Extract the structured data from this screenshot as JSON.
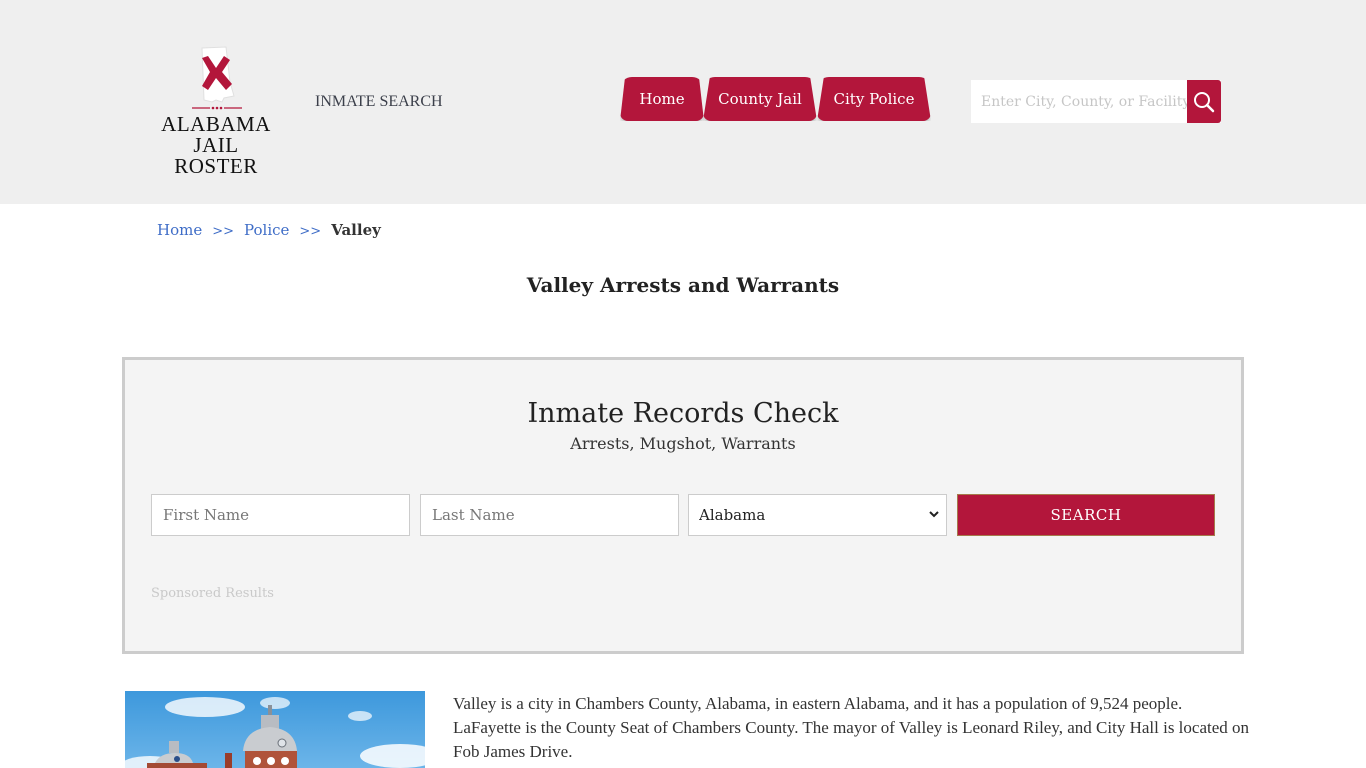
{
  "header": {
    "logo": {
      "line1": "ALABAMA",
      "line2": "JAIL ROSTER",
      "flag_color": "#b3163b"
    },
    "tagline": "INMATE SEARCH",
    "nav": [
      {
        "label": "Home"
      },
      {
        "label": "County Jail"
      },
      {
        "label": "City Police"
      }
    ],
    "search": {
      "placeholder": "Enter City, County, or Facility",
      "icon": "search-icon"
    }
  },
  "breadcrumb": {
    "items": [
      {
        "label": "Home"
      },
      {
        "label": "Police"
      }
    ],
    "separator": ">>",
    "current": "Valley"
  },
  "page_title": "Valley Arrests and Warrants",
  "records_check": {
    "title": "Inmate Records Check",
    "subtitle": "Arrests, Mugshot, Warrants",
    "first_name_placeholder": "First Name",
    "last_name_placeholder": "Last Name",
    "state_selected": "Alabama",
    "search_label": "SEARCH",
    "sponsored": "Sponsored Results"
  },
  "about": {
    "image_alt": "Valley city hall dome",
    "text": "Valley is a city in Chambers County, Alabama, in eastern Alabama, and it has a population of 9,524 people. LaFayette is the County Seat of Chambers County. The mayor of Valley is Leonard Riley, and City Hall is located on Fob James Drive."
  },
  "colors": {
    "brand": "#b3163b",
    "link": "#3f6dc7",
    "header_bg": "#efefef"
  }
}
